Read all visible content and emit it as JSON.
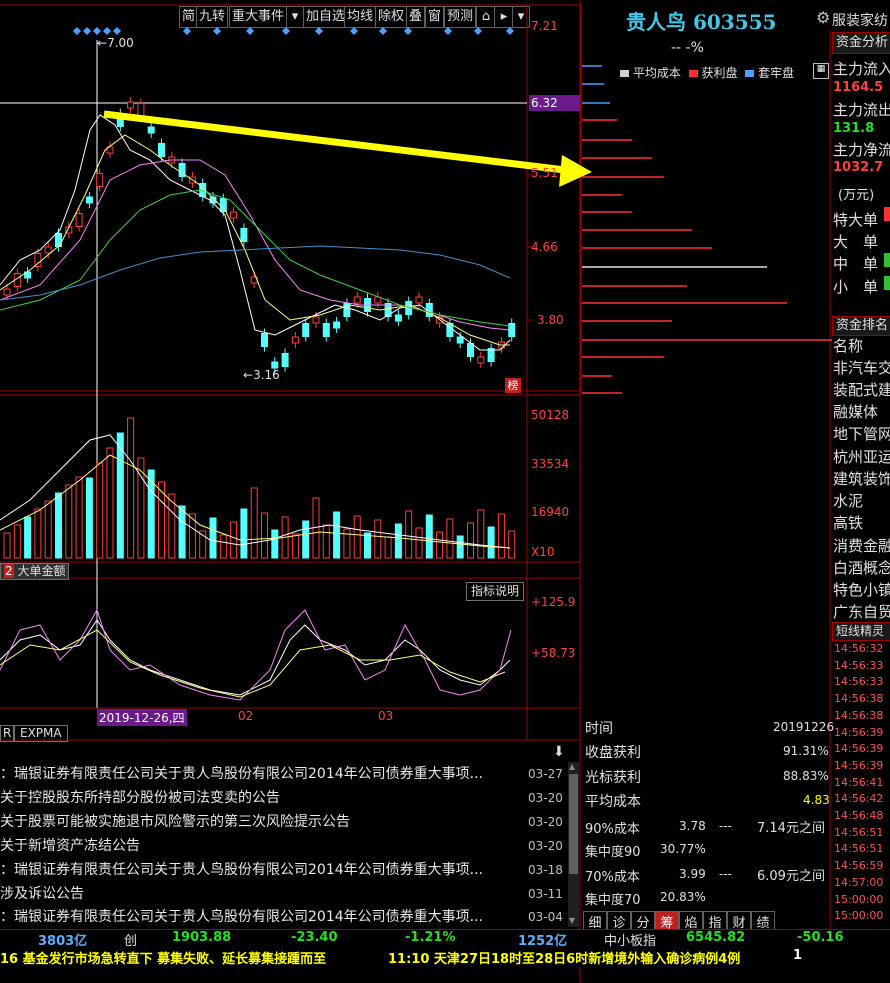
{
  "toolbar": {
    "items": [
      "简",
      "九转",
      "重大事件",
      "加自选",
      "均线",
      "除权",
      "叠",
      "窗",
      "预测"
    ]
  },
  "stock": {
    "name": "贵人鸟 603555",
    "change": "-- -%",
    "industry": "服装家纺"
  },
  "chart_axes": {
    "price_ticks": [
      "7.21",
      "6.32",
      "5.51",
      "4.66",
      "3.80"
    ],
    "high_label": "7.00",
    "low_label": "3.16",
    "badge": "榜",
    "volume_ticks": [
      "50128",
      "33534",
      "16940",
      "X10"
    ],
    "indicator_ticks": [
      "+125.9",
      "+58.73"
    ],
    "date_cursor": "2019-12-26,四",
    "date_ticks": [
      "02",
      "03"
    ]
  },
  "subpanels": {
    "volume_tab": "大单金额",
    "indicator_button": "指标说明",
    "bottom_tabs": [
      "R",
      "EXPMA"
    ]
  },
  "chip_legend": {
    "avg_cost": "平均成本",
    "profit": "获利盘",
    "trapped": "套牢盘"
  },
  "fund_analysis": {
    "title": "资金分析",
    "rows": [
      {
        "label": "主力流入",
        "value": "1164.5"
      },
      {
        "label": "主力流出",
        "value": "131.8"
      },
      {
        "label": "主力净流",
        "value": "1032.7"
      }
    ],
    "unit": "(万元)",
    "sizes": [
      "特大单",
      "大　单",
      "中　单",
      "小　单"
    ]
  },
  "fund_rank": {
    "title": "资金排名",
    "header": "名称",
    "items": [
      "非汽车交",
      "装配式建",
      "融媒体",
      "地下管网",
      "杭州亚运",
      "建筑装饰",
      "水泥",
      "高铁",
      "消费金融",
      "白酒概念",
      "特色小镇",
      "广东自贸"
    ]
  },
  "ticks": {
    "title": "短线精灵",
    "times": [
      "14:56:32",
      "14:56:33",
      "14:56:33",
      "14:56:38",
      "14:56:38",
      "14:56:39",
      "14:56:39",
      "14:56:39",
      "14:56:41",
      "14:56:42",
      "14:56:48",
      "14:56:51",
      "14:56:51",
      "14:56:59",
      "14:57:00",
      "15:00:00",
      "15:00:00"
    ]
  },
  "news": {
    "items": [
      {
        "title": "：瑞银证券有限责任公司关于贵人鸟股份有限公司2014年公司债券重大事项...",
        "date": "03-27"
      },
      {
        "title": "关于控股股东所持部分股份被司法变卖的公告",
        "date": "03-20"
      },
      {
        "title": "关于股票可能被实施退市风险警示的第三次风险提示公告",
        "date": "03-20"
      },
      {
        "title": "关于新增资产冻结公告",
        "date": "03-20"
      },
      {
        "title": "：瑞银证券有限责任公司关于贵人鸟股份有限公司2014年公司债券重大事项...",
        "date": "03-18"
      },
      {
        "title": "涉及诉讼公告",
        "date": "03-11"
      },
      {
        "title": "：瑞银证券有限责任公司关于贵人鸟股份有限公司2014年公司债券重大事项...",
        "date": "03-04"
      }
    ]
  },
  "chip_stats": {
    "time_label": "时间",
    "time_value": "20191226",
    "profit_label": "收盘获利",
    "profit_value": "91.31%",
    "cursor_label": "光标获利",
    "cursor_value": "88.83%",
    "avg_label": "平均成本",
    "avg_value": "4.83",
    "c90_label": "90%成本",
    "c90_low": "3.78",
    "c90_dash": "---",
    "c90_high": "7.14元之间",
    "conc90_label": "集中度90",
    "conc90_value": "30.77%",
    "c70_label": "70%成本",
    "c70_low": "3.99",
    "c70_dash": "---",
    "c70_high": "6.09元之间",
    "conc70_label": "集中度70",
    "conc70_value": "20.83%",
    "tabs": [
      "细",
      "诊",
      "分",
      "筹",
      "焰",
      "指",
      "财",
      "绩"
    ]
  },
  "index_bar": {
    "a1": "3803亿",
    "chuang": "创",
    "chuang_val": "1903.88",
    "chuang_chg": "-23.40",
    "chuang_pct": "-1.21%",
    "amt": "1252亿",
    "zxb": "中小板指",
    "zxb_val": "6545.82",
    "zxb_chg": "-50.16"
  },
  "ticker": {
    "left": "16 基金发行市场急转直下 募集失败、延长募集接踵而至",
    "right": "11:10 天津27日18时至28日6时新增境外输入确诊病例4例",
    "corner": "1"
  },
  "colors": {
    "up": "#ff3c3c",
    "down": "#54ffff",
    "arrow": "#ffff00",
    "bg": "#000000"
  }
}
